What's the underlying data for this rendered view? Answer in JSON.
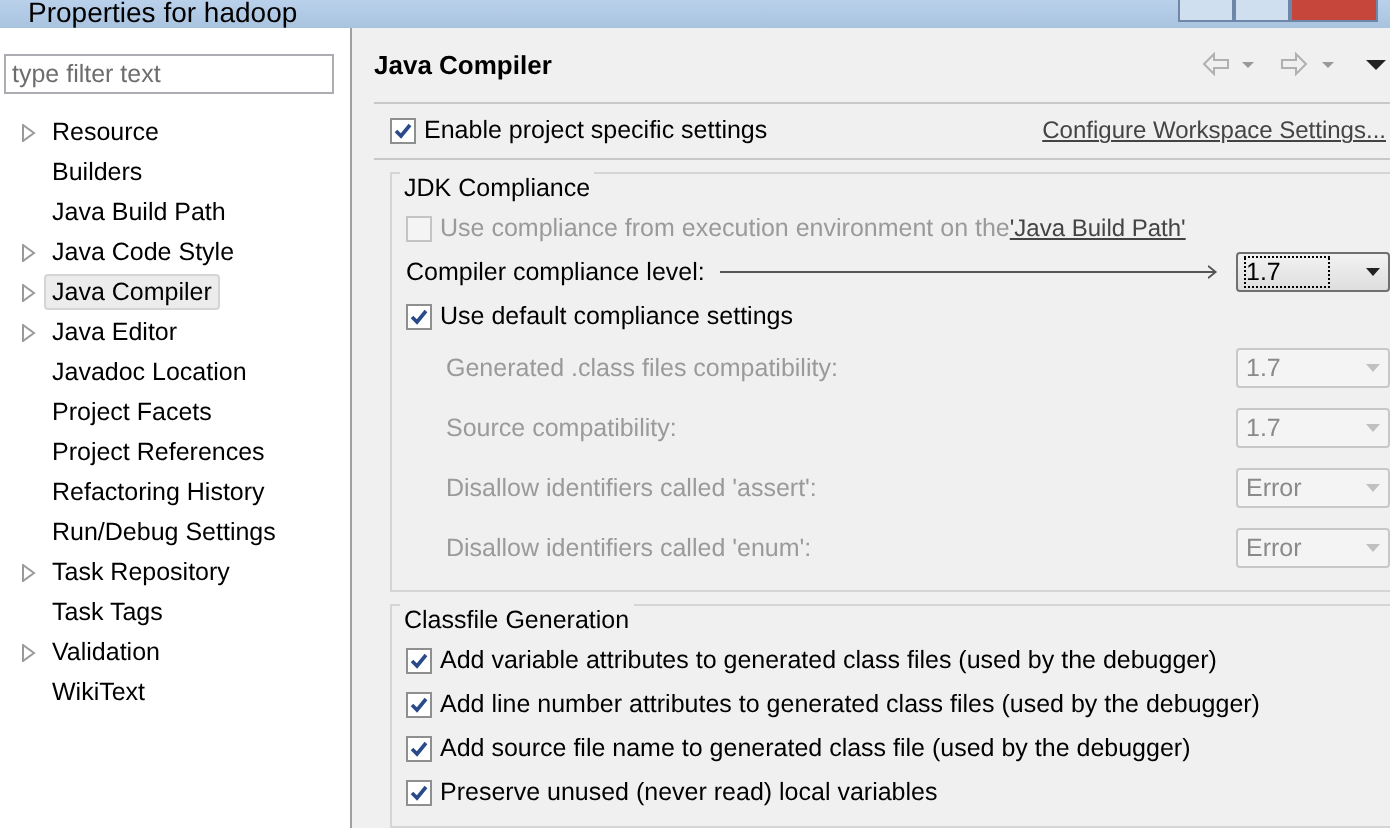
{
  "window": {
    "title": "Properties for hadoop"
  },
  "filter": {
    "placeholder": "type filter text"
  },
  "tree": [
    {
      "label": "Resource",
      "expandable": true,
      "selected": false
    },
    {
      "label": "Builders",
      "expandable": false,
      "selected": false
    },
    {
      "label": "Java Build Path",
      "expandable": false,
      "selected": false
    },
    {
      "label": "Java Code Style",
      "expandable": true,
      "selected": false
    },
    {
      "label": "Java Compiler",
      "expandable": true,
      "selected": true
    },
    {
      "label": "Java Editor",
      "expandable": true,
      "selected": false
    },
    {
      "label": "Javadoc Location",
      "expandable": false,
      "selected": false
    },
    {
      "label": "Project Facets",
      "expandable": false,
      "selected": false
    },
    {
      "label": "Project References",
      "expandable": false,
      "selected": false
    },
    {
      "label": "Refactoring History",
      "expandable": false,
      "selected": false
    },
    {
      "label": "Run/Debug Settings",
      "expandable": false,
      "selected": false
    },
    {
      "label": "Task Repository",
      "expandable": true,
      "selected": false
    },
    {
      "label": "Task Tags",
      "expandable": false,
      "selected": false
    },
    {
      "label": "Validation",
      "expandable": true,
      "selected": false
    },
    {
      "label": "WikiText",
      "expandable": false,
      "selected": false
    }
  ],
  "page": {
    "title": "Java Compiler",
    "enable": {
      "label": "Enable project specific settings",
      "checked": true
    },
    "configure_link": "Configure Workspace Settings...",
    "jdk": {
      "title": "JDK Compliance",
      "use_env": {
        "label": "Use compliance from execution environment on the ",
        "link": "'Java Build Path'",
        "checked": false,
        "disabled": true
      },
      "level": {
        "label": "Compiler compliance level:",
        "value": "1.7"
      },
      "use_default": {
        "label": "Use default compliance settings",
        "checked": true
      },
      "settings": [
        {
          "label": "Generated .class files compatibility:",
          "value": "1.7",
          "disabled": true
        },
        {
          "label": "Source compatibility:",
          "value": "1.7",
          "disabled": true
        },
        {
          "label": "Disallow identifiers called 'assert':",
          "value": "Error",
          "disabled": true
        },
        {
          "label": "Disallow identifiers called 'enum':",
          "value": "Error",
          "disabled": true
        }
      ]
    },
    "classfile": {
      "title": "Classfile Generation",
      "options": [
        {
          "label": "Add variable attributes to generated class files (used by the debugger)",
          "checked": true
        },
        {
          "label": "Add line number attributes to generated class files (used by the debugger)",
          "checked": true
        },
        {
          "label": "Add source file name to generated class file (used by the debugger)",
          "checked": true
        },
        {
          "label": "Preserve unused (never read) local variables",
          "checked": true
        }
      ]
    }
  }
}
